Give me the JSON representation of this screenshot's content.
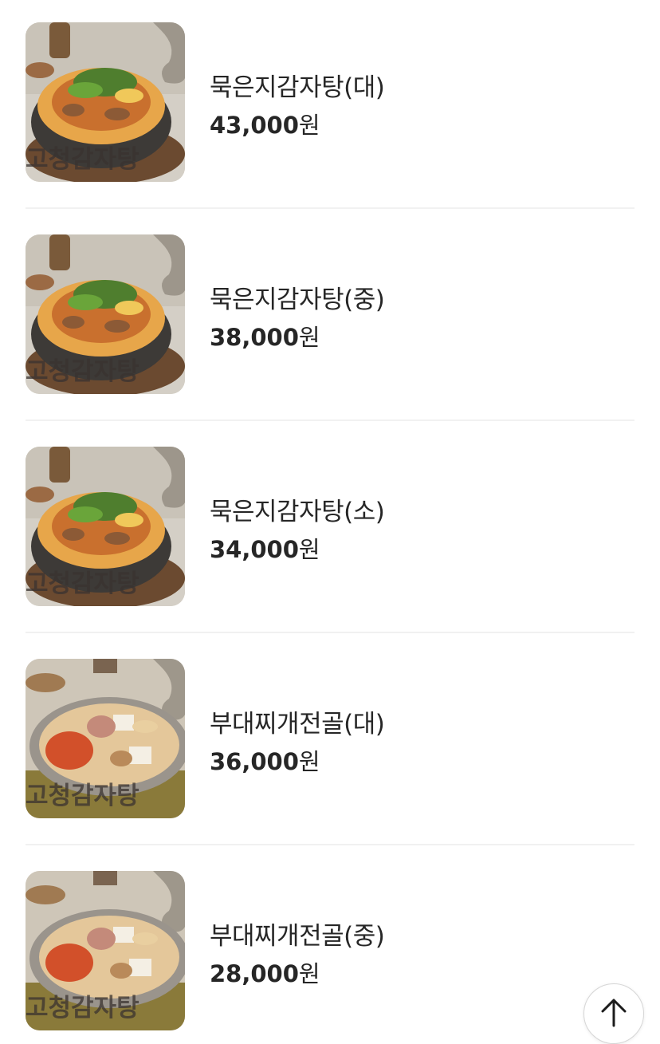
{
  "menu": {
    "items": [
      {
        "name": "묵은지감자탕(대)",
        "price": "43,000",
        "unit": "원",
        "image": "kimchi-pot"
      },
      {
        "name": "묵은지감자탕(중)",
        "price": "38,000",
        "unit": "원",
        "image": "kimchi-pot"
      },
      {
        "name": "묵은지감자탕(소)",
        "price": "34,000",
        "unit": "원",
        "image": "kimchi-pot"
      },
      {
        "name": "부대찌개전골(대)",
        "price": "36,000",
        "unit": "원",
        "image": "budae-pan"
      },
      {
        "name": "부대찌개전골(중)",
        "price": "28,000",
        "unit": "원",
        "image": "budae-pan"
      }
    ],
    "watermark": "고청감자탕"
  },
  "scroll_top": {
    "icon": "arrow-up-icon"
  },
  "colors": {
    "text": "#262626",
    "divider": "#f1f1f1",
    "background": "#ffffff"
  }
}
